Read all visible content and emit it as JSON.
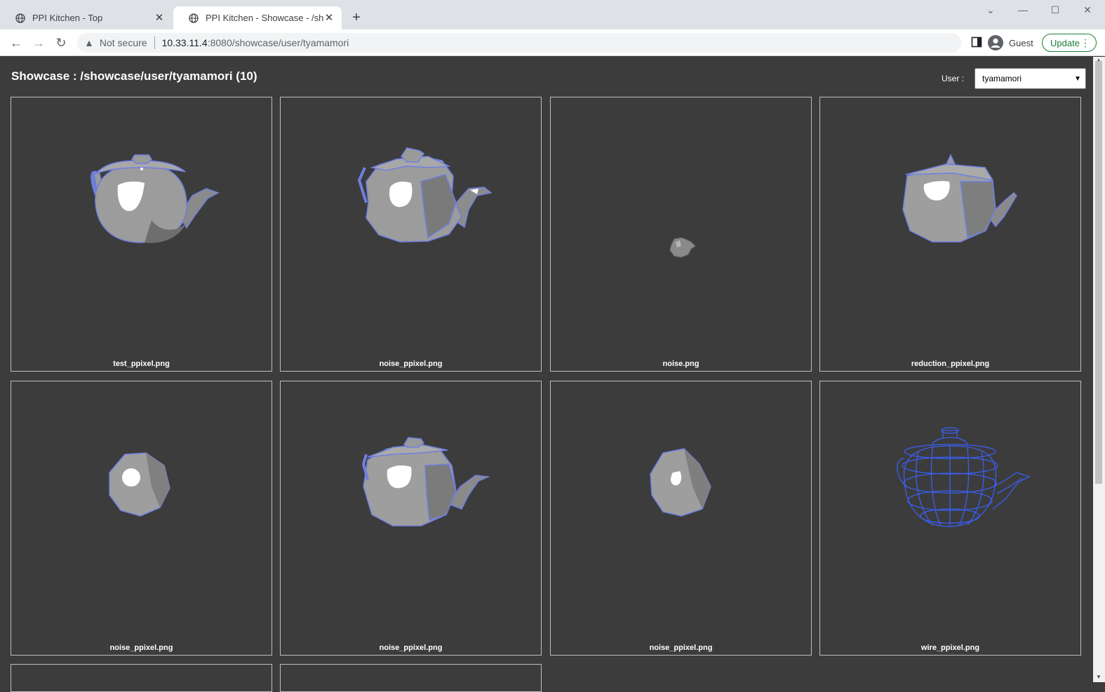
{
  "browser": {
    "tabs": [
      {
        "title": "PPI Kitchen - Top"
      },
      {
        "title": "PPI Kitchen - Showcase - /showcase/user/tyamamori"
      }
    ],
    "address": {
      "security_label": "Not secure",
      "host": "10.33.11.4",
      "path": ":8080/showcase/user/tyamamori"
    },
    "profile_label": "Guest",
    "update_label": "Update"
  },
  "page": {
    "heading": "Showcase : /showcase/user/tyamamori (10)",
    "user_label": "User :",
    "user_selected": "tyamamori"
  },
  "cards": [
    {
      "caption": "test_ppixel.png",
      "kind": "teapot-smooth"
    },
    {
      "caption": "noise_ppixel.png",
      "kind": "teapot-noisy"
    },
    {
      "caption": "noise.png",
      "kind": "teapot-tiny"
    },
    {
      "caption": "reduction_ppixel.png",
      "kind": "teapot-lowpoly"
    },
    {
      "caption": "noise_ppixel.png",
      "kind": "blob-round"
    },
    {
      "caption": "noise_ppixel.png",
      "kind": "teapot-noisy"
    },
    {
      "caption": "noise_ppixel.png",
      "kind": "blob-rock"
    },
    {
      "caption": "wire_ppixel.png",
      "kind": "teapot-wire"
    }
  ],
  "colors": {
    "page_bg": "#3c3c3c",
    "outline_blue": "#6f7fe0",
    "wire_blue": "#3a5ef0",
    "body_grey": "#9a9a9a"
  }
}
